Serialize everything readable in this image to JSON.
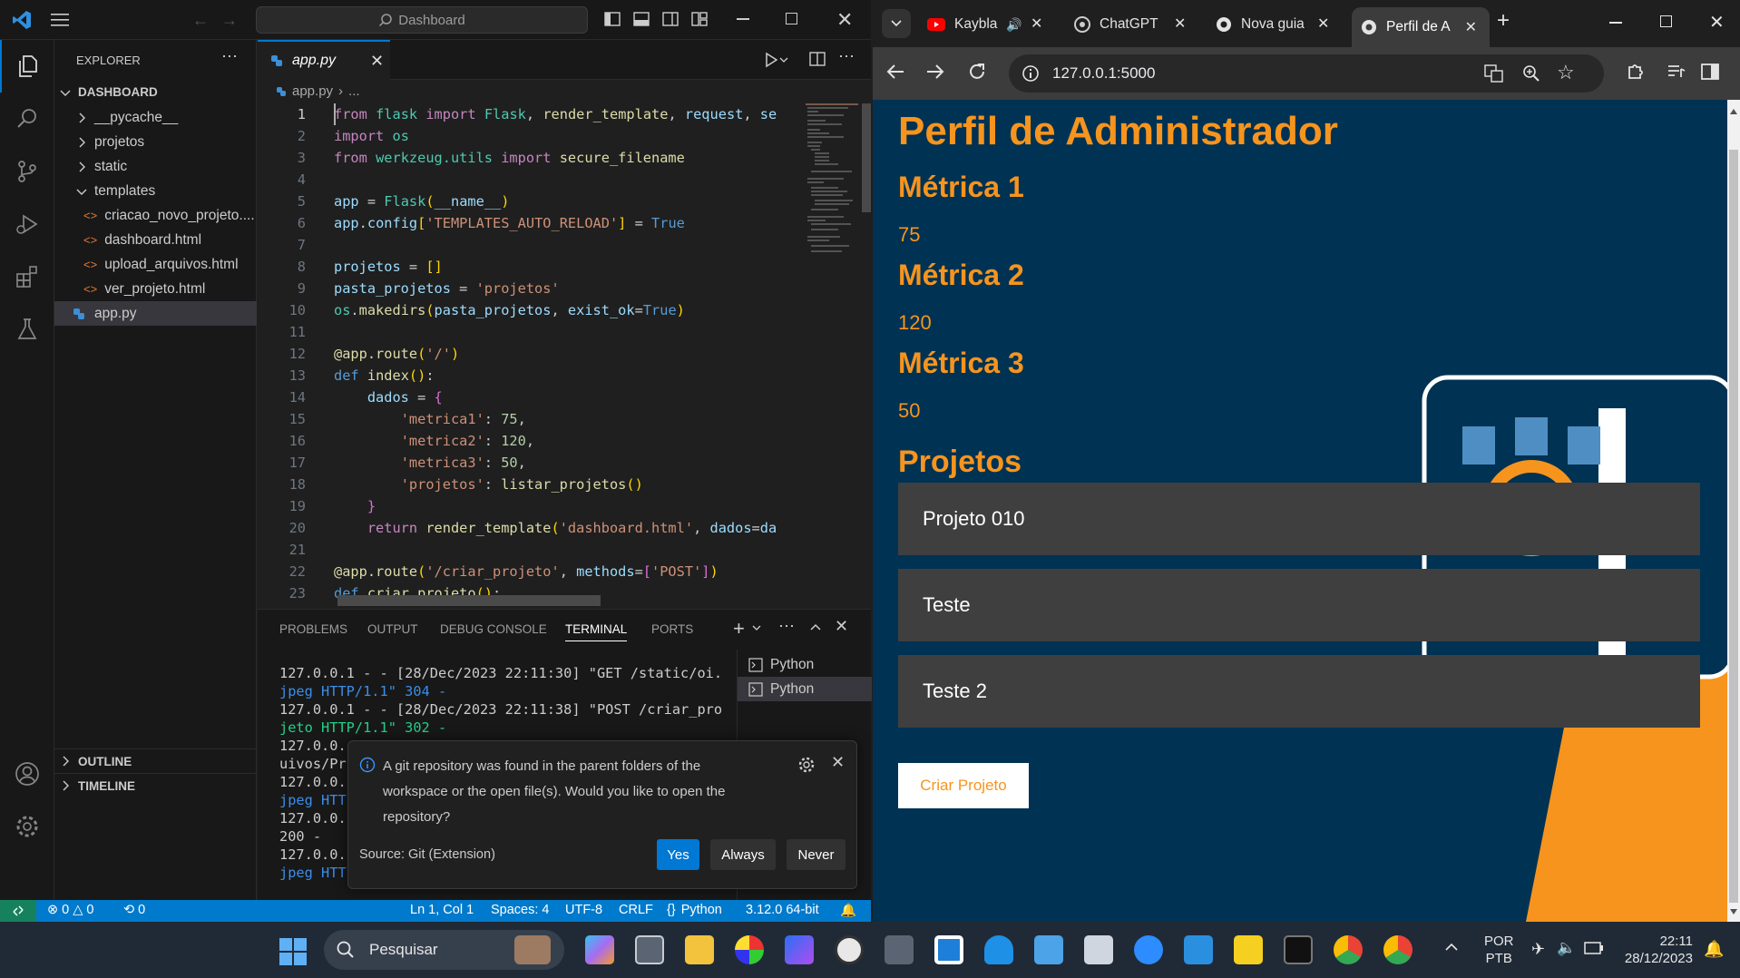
{
  "vscode": {
    "search_label": "Dashboard",
    "explorer_title": "EXPLORER",
    "folder_name": "DASHBOARD",
    "tree": [
      {
        "label": "__pycache__",
        "kind": "folder",
        "expanded": false
      },
      {
        "label": "projetos",
        "kind": "folder",
        "expanded": false
      },
      {
        "label": "static",
        "kind": "folder",
        "expanded": false
      },
      {
        "label": "templates",
        "kind": "folder",
        "expanded": true
      },
      {
        "label": "criacao_novo_projeto....",
        "kind": "html"
      },
      {
        "label": "dashboard.html",
        "kind": "html"
      },
      {
        "label": "upload_arquivos.html",
        "kind": "html"
      },
      {
        "label": "ver_projeto.html",
        "kind": "html"
      },
      {
        "label": "app.py",
        "kind": "python",
        "selected": true
      }
    ],
    "outline_label": "OUTLINE",
    "timeline_label": "TIMELINE",
    "tab_label": "app.py",
    "breadcrumb_file": "app.py",
    "breadcrumb_rest": "...",
    "code_lines": [
      "1",
      "2",
      "3",
      "4",
      "5",
      "6",
      "7",
      "8",
      "9",
      "10",
      "11",
      "12",
      "13",
      "14",
      "15",
      "16",
      "17",
      "18",
      "19",
      "20",
      "21",
      "22",
      "23"
    ],
    "panel_tabs": [
      "PROBLEMS",
      "OUTPUT",
      "DEBUG CONSOLE",
      "TERMINAL",
      "PORTS"
    ],
    "active_panel_tab": "TERMINAL",
    "terminal_lines": [
      "127.0.0.1 - - [28/Dec/2023 22:11:30] \"GET /static/oi.",
      "jpeg HTTP/1.1\" 304 -",
      "127.0.0.1 - - [28/Dec/2023 22:11:38] \"POST /criar_pro",
      "jeto HTTP/1.1\" 302 -",
      "127.0.0.",
      "uivos/Pr",
      "127.0.0.",
      "jpeg HTT",
      "127.0.0.",
      " 200 -",
      "127.0.0.",
      "jpeg HTT"
    ],
    "terminals": [
      "Python",
      "Python"
    ],
    "notification": {
      "message": "A git repository was found in the parent folders of the workspace or the open file(s). Would you like to open the repository?",
      "source": "Source: Git (Extension)",
      "yes": "Yes",
      "always": "Always",
      "never": "Never"
    },
    "status": {
      "errors": "0",
      "warnings": "0",
      "ports": "0",
      "position": "Ln 1, Col 1",
      "spaces": "Spaces: 4",
      "encoding": "UTF-8",
      "eol": "CRLF",
      "language": "Python",
      "interpreter": "3.12.0 64-bit"
    }
  },
  "chrome": {
    "tabs": [
      {
        "label": "Kaybla",
        "icon": "youtube-icon"
      },
      {
        "label": "ChatGPT",
        "icon": "chatgpt-icon"
      },
      {
        "label": "Nova guia",
        "icon": "chrome-icon"
      },
      {
        "label": "Perfil de A",
        "icon": "chrome-icon",
        "active": true
      }
    ],
    "url": "127.0.0.1:5000",
    "page": {
      "title": "Perfil de Administrador",
      "metrics": [
        {
          "label": "Métrica 1",
          "value": "75"
        },
        {
          "label": "Métrica 2",
          "value": "120"
        },
        {
          "label": "Métrica 3",
          "value": "50"
        }
      ],
      "projects_title": "Projetos",
      "projects": [
        "Projeto 010",
        "Teste",
        "Teste 2"
      ],
      "create_button": "Criar Projeto",
      "accent": "#f7941d",
      "background": "#003253"
    }
  },
  "taskbar": {
    "search_placeholder": "Pesquisar",
    "lang_top": "POR",
    "lang_bottom": "PTB",
    "time": "22:11",
    "date": "28/12/2023"
  }
}
